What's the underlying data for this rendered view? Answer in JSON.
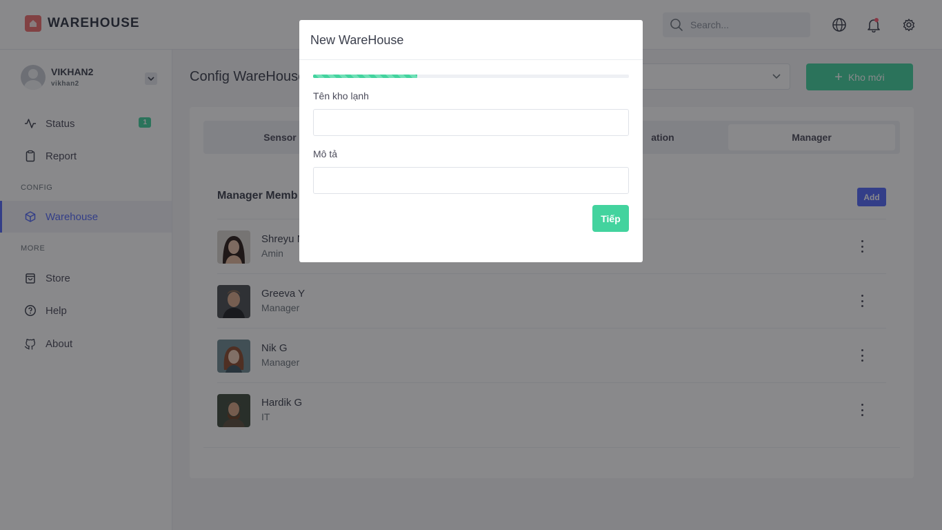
{
  "brand": {
    "name": "WAREHOUSE",
    "accent": "#43d39e",
    "primary": "#5369f8"
  },
  "topbar": {
    "search_placeholder": "Search..."
  },
  "user": {
    "name": "VIKHAN2",
    "username": "vikhan2"
  },
  "sidebar": {
    "items": [
      {
        "label": "Status",
        "badge": "1"
      },
      {
        "label": "Report"
      }
    ],
    "config_section": "CONFIG",
    "config_items": [
      {
        "label": "Warehouse"
      }
    ],
    "more_section": "MORE",
    "more_items": [
      {
        "label": "Store"
      },
      {
        "label": "Help"
      },
      {
        "label": "About"
      }
    ]
  },
  "main": {
    "title": "Config WareHouse",
    "new_button": "Kho mới",
    "tabs": [
      "Sensor",
      "ation",
      "Manager"
    ],
    "section_title": "Manager Memb",
    "add_button": "Add",
    "members": [
      {
        "name": "Shreyu N",
        "role": "Amin"
      },
      {
        "name": "Greeva Y",
        "role": "Manager"
      },
      {
        "name": "Nik G",
        "role": "Manager"
      },
      {
        "name": "Hardik G",
        "role": "IT"
      }
    ]
  },
  "modal": {
    "title": "New WareHouse",
    "progress_percent": 33,
    "field1_label": "Tên kho lạnh",
    "field1_value": "",
    "field2_label": "Mô tả",
    "field2_value": "",
    "next_button": "Tiếp"
  }
}
